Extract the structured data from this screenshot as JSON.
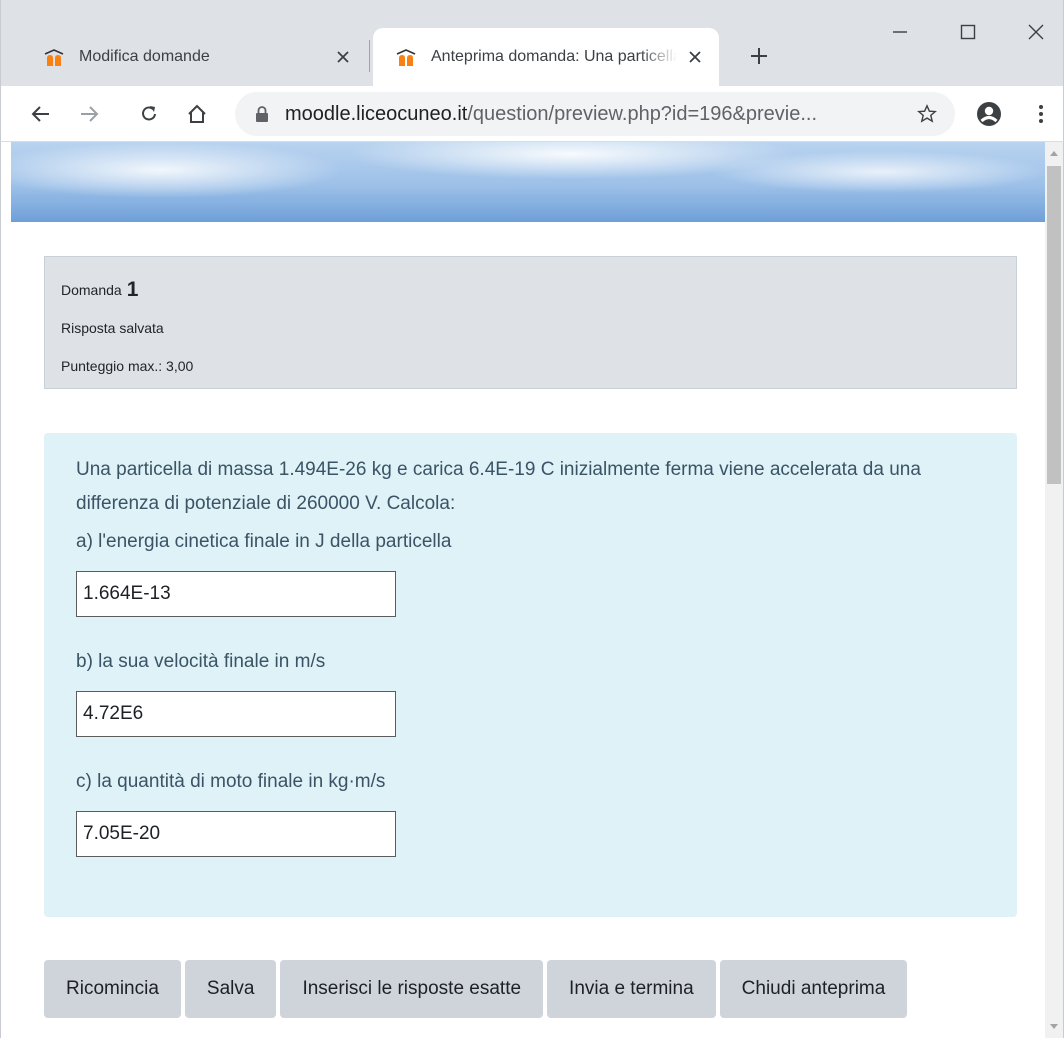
{
  "browser": {
    "tabs": [
      {
        "title": "Modifica domande",
        "active": false
      },
      {
        "title": "Anteprima domanda: Una particella di massa",
        "active": true
      }
    ],
    "url_host": "moodle.liceocuneo.it",
    "url_path": "/question/preview.php?id=196&previe...",
    "icons": {
      "back": "arrow-left-icon",
      "forward": "arrow-right-icon",
      "reload": "reload-icon",
      "home": "home-icon",
      "lock": "lock-icon",
      "star": "star-icon",
      "profile": "account-icon",
      "menu": "kebab-menu-icon"
    },
    "colors": {
      "tabstrip": "#dee1e6",
      "omnibox": "#f1f3f4",
      "favicon": "#f98012"
    }
  },
  "question_info": {
    "label": "Domanda",
    "number": "1",
    "state": "Risposta salvata",
    "grade": "Punteggio max.: 3,00"
  },
  "question": {
    "text": "Una particella di massa 1.494E-26 kg e carica 6.4E-19 C inizialmente ferma viene accelerata da una differenza di potenziale di 260000 V. Calcola:",
    "parts": [
      {
        "label": "a) l'energia cinetica finale in J della particella",
        "value": "1.664E-13"
      },
      {
        "label": "b) la sua velocità finale in m/s",
        "value": "4.72E6"
      },
      {
        "label": "c) la quantità di moto finale in kg·m/s",
        "value": "7.05E-20"
      }
    ],
    "colors": {
      "background": "#def2f8",
      "text": "#3b5465"
    }
  },
  "buttons": {
    "restart": "Ricomincia",
    "save": "Salva",
    "fill_correct": "Inserisci le risposte esatte",
    "submit": "Invia e termina",
    "close": "Chiudi anteprima"
  }
}
